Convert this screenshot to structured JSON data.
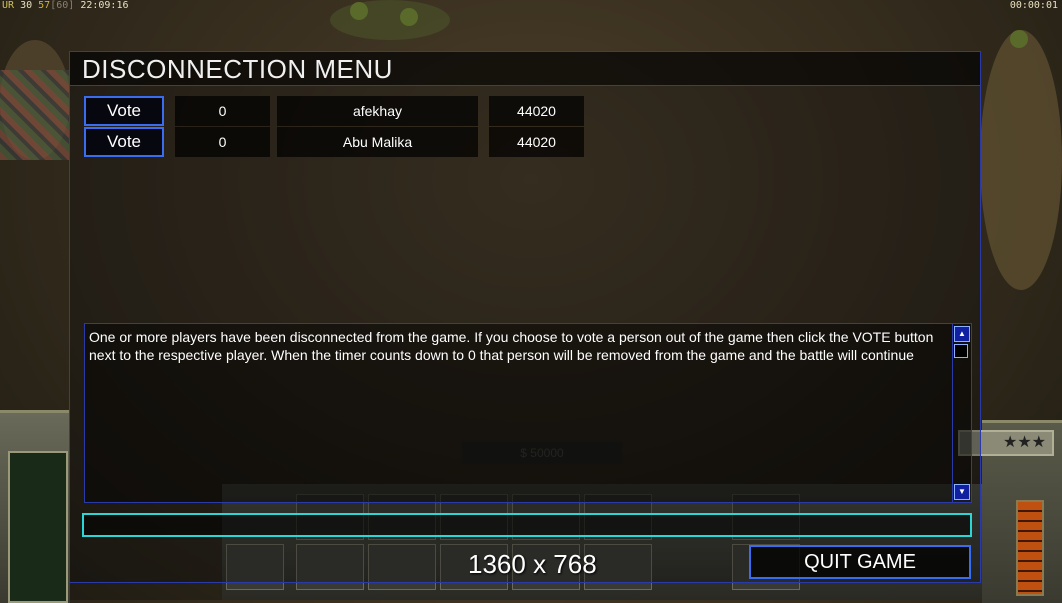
{
  "stats": {
    "ur_label": "UR",
    "ur_value": "30",
    "fps": "57",
    "fps_cap": "[60]",
    "clock": "22:09:16",
    "timer": "00:00:01"
  },
  "hud": {
    "money": "$ 50000",
    "rank": "★★★"
  },
  "menu": {
    "title": "DISCONNECTION MENU",
    "players": [
      {
        "vote_label": "Vote",
        "votes": "0",
        "name": "afekhay",
        "ping": "44020"
      },
      {
        "vote_label": "Vote",
        "votes": "0",
        "name": "Abu Malika",
        "ping": "44020"
      }
    ],
    "message": "One or more players have been disconnected from the game. If you choose to vote a person out of the game then click the VOTE button next to the respective player. When the timer counts down to 0 that person will be removed from the game and the battle will continue",
    "chat_value": "",
    "quit_label": "QUIT GAME"
  },
  "resolution": "1360 x 768",
  "colors": {
    "frame_blue": "#2a3aa8",
    "button_border": "#3a6cf0",
    "chat_border": "#2ad6d6"
  }
}
